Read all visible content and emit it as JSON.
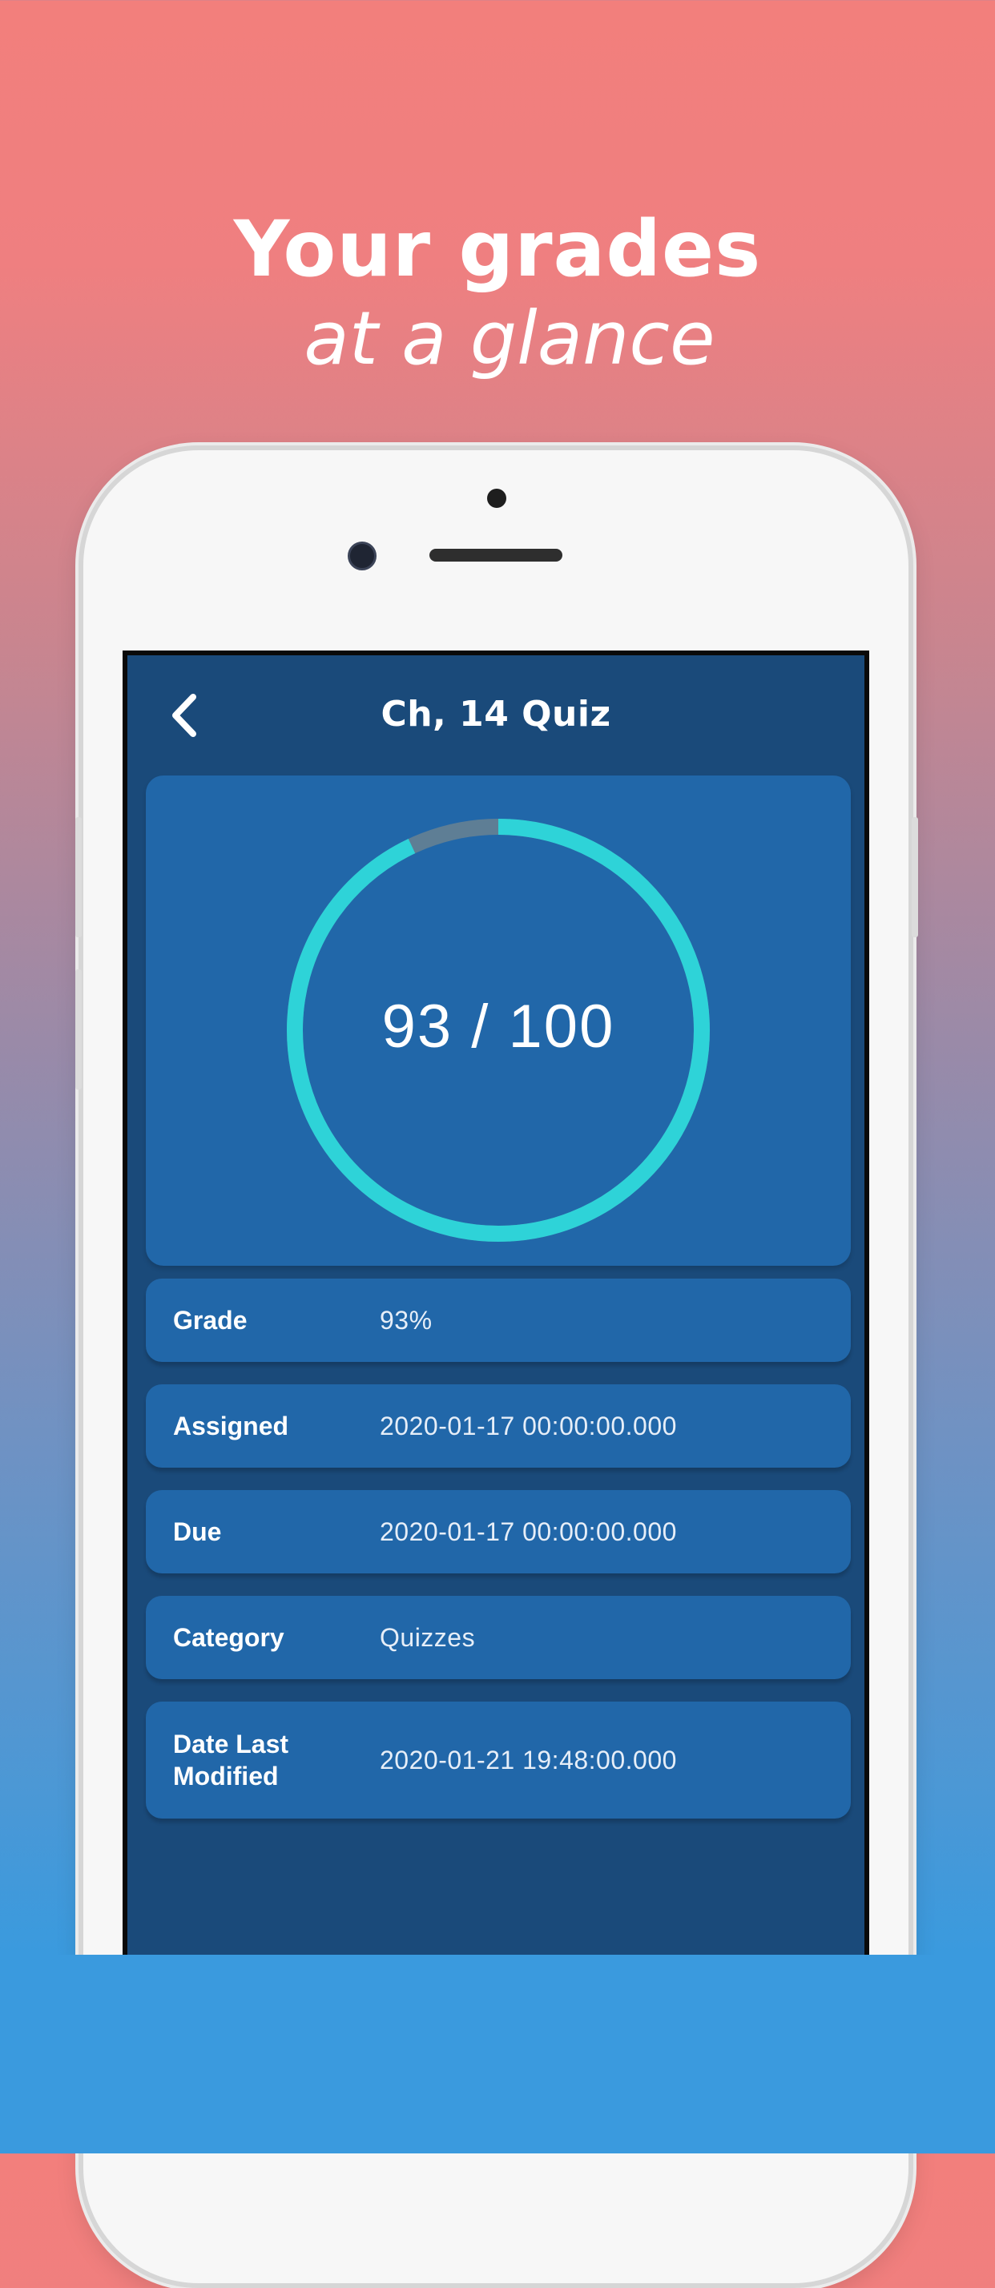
{
  "headline": {
    "line1": "Your grades",
    "line2": "at a glance"
  },
  "screen": {
    "title": "Ch, 14 Quiz",
    "back_icon": "chevron-left-icon",
    "score": {
      "text": "93 / 100",
      "earned": 93,
      "total": 100,
      "ring_color": "#2ed3d8",
      "ring_remainder_color": "#5e7e95"
    },
    "details": [
      {
        "label": "Grade",
        "value": "93%"
      },
      {
        "label": "Assigned",
        "value": "2020-01-17 00:00:00.000"
      },
      {
        "label": "Due",
        "value": "2020-01-17 00:00:00.000"
      },
      {
        "label": "Category",
        "value": "Quizzes"
      },
      {
        "label": "Date Last Modified",
        "value": "2020-01-21 19:48:00.000"
      }
    ]
  },
  "colors": {
    "screen_bg": "#1a4a7a",
    "card_bg": "#2167a9",
    "background_top": "#f27f7c",
    "background_bottom": "#3a9ade"
  }
}
